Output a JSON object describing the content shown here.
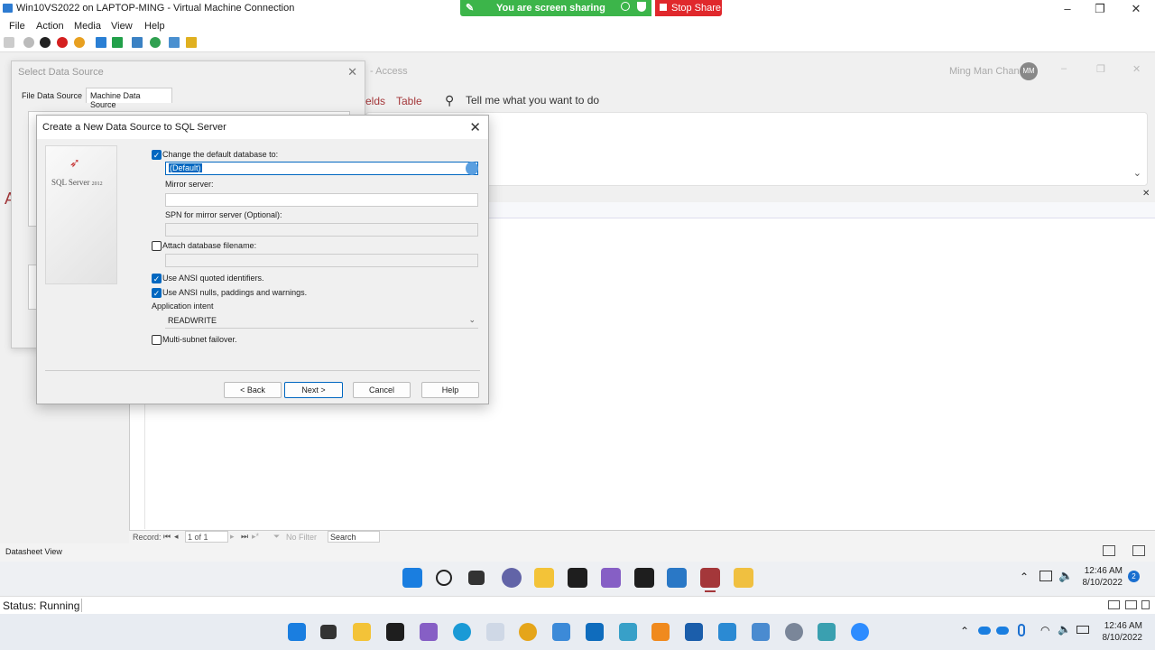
{
  "vm": {
    "title": "Win10VS2022 on LAPTOP-MING - Virtual Machine Connection",
    "menu": [
      "File",
      "Action",
      "Media",
      "View",
      "Help"
    ],
    "status": "Status: Running"
  },
  "share": {
    "message": "You are screen sharing",
    "stop_label": "Stop Share"
  },
  "access": {
    "title_fragment": "- Access",
    "user_name": "Ming Man Chan",
    "user_initials": "MM",
    "ribbon_tabs": [
      "elds",
      "Table"
    ],
    "tell_me": "Tell me what you want to do",
    "record_label": "Record:",
    "record_value": "1 of 1",
    "filter_label": "No Filter",
    "search_label": "Search",
    "view_label": "Datasheet View",
    "left_letter": "A"
  },
  "select_data_source": {
    "title": "Select Data Source",
    "tabs": [
      "File Data Source",
      "Machine Data Source"
    ]
  },
  "dialog": {
    "title": "Create a New Data Source to SQL Server",
    "logo_text": "SQL Server",
    "logo_version": "2012",
    "change_db_label": "Change the default database to:",
    "change_db_checked": true,
    "default_db_value": "(Default)",
    "mirror_label": "Mirror server:",
    "mirror_value": "",
    "spn_label": "SPN for mirror server (Optional):",
    "spn_value": "",
    "attach_label": "Attach database filename:",
    "attach_checked": false,
    "ansi_quoted_label": "Use ANSI quoted identifiers.",
    "ansi_quoted_checked": true,
    "ansi_nulls_label": "Use ANSI nulls, paddings and warnings.",
    "ansi_nulls_checked": true,
    "app_intent_label": "Application intent",
    "app_intent_value": "READWRITE",
    "multisubnet_label": "Multi-subnet failover.",
    "multisubnet_checked": false,
    "buttons": {
      "back": "< Back",
      "next": "Next >",
      "cancel": "Cancel",
      "help": "Help"
    }
  },
  "guest_clock": {
    "time": "12:46 AM",
    "date": "8/10/2022",
    "badge": "2"
  },
  "host_clock": {
    "time": "12:46 AM",
    "date": "8/10/2022"
  },
  "colors": {
    "accent": "#0067c0",
    "share_green": "#3cb54a",
    "share_red": "#e0282c",
    "access_red": "#a4373a"
  }
}
